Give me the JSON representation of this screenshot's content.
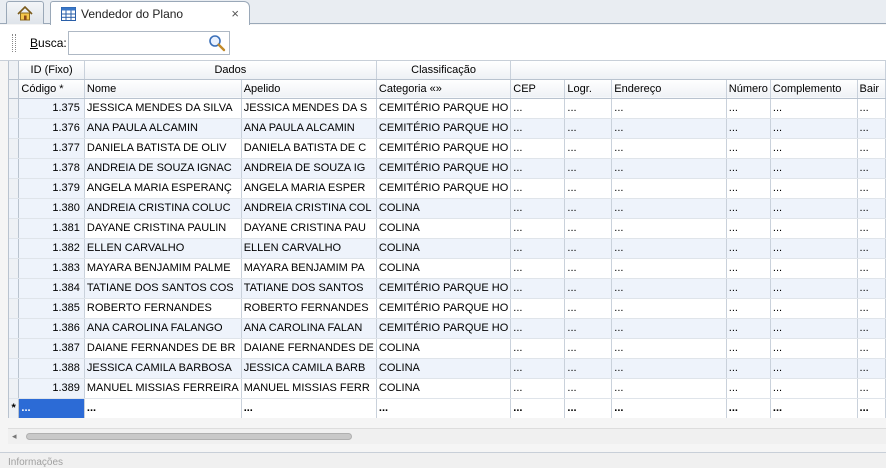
{
  "tabs": {
    "home_icon": "home-icon",
    "active": {
      "title": "Vendedor do Plano",
      "close": "×"
    }
  },
  "toolbar": {
    "search_label_accel": "B",
    "search_label_rest": "usca:",
    "search_value": ""
  },
  "grid": {
    "bands": [
      "ID (Fixo)",
      "Dados",
      "Classificação",
      ""
    ],
    "columns": [
      "Código *",
      "Nome",
      "Apelido",
      "Categoria «»",
      "CEP",
      "Logr.",
      "Endereço",
      "Número",
      "Complemento",
      "Bair"
    ],
    "rows": [
      [
        "1.375",
        "JESSICA MENDES DA SILVA",
        "JESSICA MENDES DA S",
        "CEMITÉRIO PARQUE HO",
        "...",
        "...",
        "...",
        "...",
        "...",
        "..."
      ],
      [
        "1.376",
        "ANA PAULA ALCAMIN",
        "ANA PAULA ALCAMIN",
        "CEMITÉRIO PARQUE HO",
        "...",
        "...",
        "...",
        "...",
        "...",
        "..."
      ],
      [
        "1.377",
        "DANIELA BATISTA DE OLIV",
        "DANIELA BATISTA DE C",
        "CEMITÉRIO PARQUE HO",
        "...",
        "...",
        "...",
        "...",
        "...",
        "..."
      ],
      [
        "1.378",
        "ANDREIA DE SOUZA IGNAC",
        "ANDREIA DE SOUZA IG",
        "CEMITÉRIO PARQUE HO",
        "...",
        "...",
        "...",
        "...",
        "...",
        "..."
      ],
      [
        "1.379",
        "ANGELA MARIA ESPERANÇ",
        "ANGELA MARIA ESPER",
        "CEMITÉRIO PARQUE HO",
        "...",
        "...",
        "...",
        "...",
        "...",
        "..."
      ],
      [
        "1.380",
        "ANDREIA CRISTINA COLUC",
        "ANDREIA CRISTINA COL",
        "COLINA",
        "...",
        "...",
        "...",
        "...",
        "...",
        "..."
      ],
      [
        "1.381",
        "DAYANE CRISTINA PAULIN",
        "DAYANE CRISTINA PAU",
        "COLINA",
        "...",
        "...",
        "...",
        "...",
        "...",
        "..."
      ],
      [
        "1.382",
        "ELLEN CARVALHO",
        "ELLEN CARVALHO",
        "COLINA",
        "...",
        "...",
        "...",
        "...",
        "...",
        "..."
      ],
      [
        "1.383",
        "MAYARA BENJAMIM PALME",
        "MAYARA BENJAMIM PA",
        "COLINA",
        "...",
        "...",
        "...",
        "...",
        "...",
        "..."
      ],
      [
        "1.384",
        "TATIANE DOS SANTOS COS",
        "TATIANE DOS SANTOS",
        "CEMITÉRIO PARQUE HO",
        "...",
        "...",
        "...",
        "...",
        "...",
        "..."
      ],
      [
        "1.385",
        "ROBERTO FERNANDES",
        "ROBERTO FERNANDES",
        "CEMITÉRIO PARQUE HO",
        "...",
        "...",
        "...",
        "...",
        "...",
        "..."
      ],
      [
        "1.386",
        "ANA CAROLINA FALANGO",
        "ANA CAROLINA FALAN",
        "CEMITÉRIO PARQUE HO",
        "...",
        "...",
        "...",
        "...",
        "...",
        "..."
      ],
      [
        "1.387",
        "DAIANE FERNANDES DE BR",
        "DAIANE FERNANDES DE",
        "COLINA",
        "...",
        "...",
        "...",
        "...",
        "...",
        "..."
      ],
      [
        "1.388",
        "JESSICA CAMILA BARBOSA",
        "JESSICA CAMILA BARB",
        "COLINA",
        "...",
        "...",
        "...",
        "...",
        "...",
        "..."
      ],
      [
        "1.389",
        "MANUEL MISSIAS FERREIRA",
        "MANUEL MISSIAS FERR",
        "COLINA",
        "...",
        "...",
        "...",
        "...",
        "...",
        "..."
      ]
    ],
    "new_row_marker": "*",
    "new_row": [
      "...",
      "...",
      "...",
      "...",
      "...",
      "...",
      "...",
      "...",
      "...",
      "..."
    ]
  },
  "info_panel": {
    "label": "Informações"
  }
}
